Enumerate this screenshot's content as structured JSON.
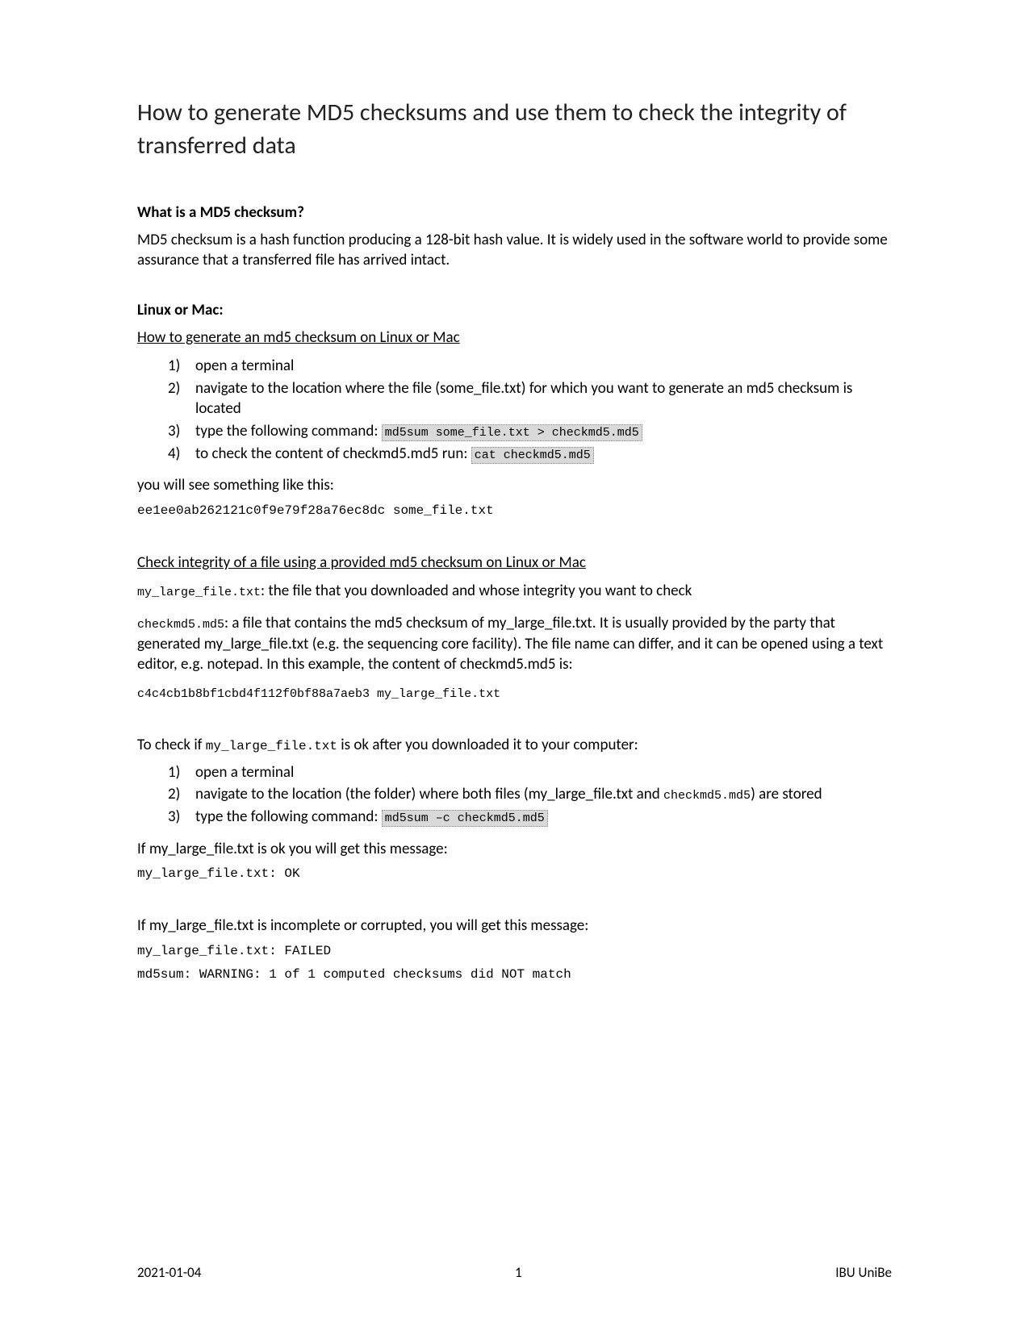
{
  "title": "How to generate MD5 checksums and use them to check the integrity of transferred data",
  "h1": "What is a MD5 checksum?",
  "p1": "MD5 checksum is a hash function producing a 128-bit hash value. It is widely used in the software world to provide some assurance that a transferred file has arrived intact.",
  "h2": "Linux or Mac:",
  "sub1": "How to generate an md5 checksum on Linux or Mac",
  "gen": {
    "n1": "1)",
    "s1": "open a terminal",
    "n2": "2)",
    "s2": "navigate to the location where the file (some_file.txt) for which you want to generate an md5 checksum is located",
    "n3": "3)",
    "s3a": "type the following command: ",
    "s3b": "md5sum some_file.txt > checkmd5.md5",
    "n4": "4)",
    "s4a": "to check the content of checkmd5.md5 run: ",
    "s4b": "cat  checkmd5.md5"
  },
  "p2": "you will see something like this:",
  "out1": "ee1ee0ab262121c0f9e79f28a76ec8dc  some_file.txt",
  "sub2": "Check integrity of a file using a provided md5 checksum on Linux or Mac",
  "p3a": "my_large_file.txt",
  "p3b": ": the file that you downloaded and whose integrity you want to check",
  "p4a": "checkmd5.md5",
  "p4b": ": a file that contains the md5 checksum of my_large_file.txt. It is usually provided by the party that generated my_large_file.txt (e.g. the sequencing core facility). The file name can differ, and it can be opened using a text editor, e.g. notepad. In this example, the content of checkmd5.md5 is:",
  "out2": "c4c4cb1b8bf1cbd4f112f0bf88a7aeb3 my_large_file.txt",
  "p5a": "To check if ",
  "p5b": "my_large_file.txt",
  "p5c": " is ok after you downloaded it to your computer:",
  "chk": {
    "n1": "1)",
    "s1": "open a terminal",
    "n2": "2)",
    "s2a": "navigate to the location (the folder) where both files (my_large_file.txt and ",
    "s2b": "checkmd5.md5",
    "s2c": ") are stored",
    "n3": "3)",
    "s3a": "type the following command: ",
    "s3b": "md5sum –c checkmd5.md5"
  },
  "p6": "If my_large_file.txt is ok you will get this message:",
  "out3": "my_large_file.txt: OK",
  "p7": "If my_large_file.txt is incomplete or corrupted, you will get this message:",
  "out4a": "my_large_file.txt: FAILED",
  "out4b": "md5sum: WARNING: 1 of 1 computed checksums did NOT match",
  "footer": {
    "date": "2021-01-04",
    "page": "1",
    "org": "IBU UniBe"
  }
}
